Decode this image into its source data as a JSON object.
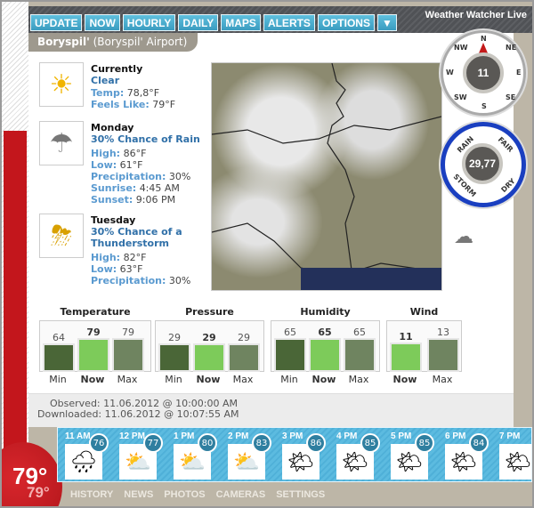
{
  "app": {
    "title": "Weather Watcher Live"
  },
  "tabs": [
    "UPDATE",
    "NOW",
    "HOURLY",
    "DAILY",
    "MAPS",
    "ALERTS",
    "OPTIONS"
  ],
  "location": {
    "name": "Boryspil'",
    "detail": "(Boryspil' Airport)"
  },
  "current": {
    "heading": "Currently",
    "condition": "Clear",
    "temp_label": "Temp:",
    "temp": "78,8°F",
    "feels_label": "Feels Like:",
    "feels": "79°F",
    "icon": "sun-icon"
  },
  "monday": {
    "heading": "Monday",
    "condition": "30% Chance of Rain",
    "high_label": "High:",
    "high": "86°F",
    "low_label": "Low:",
    "low": "61°F",
    "precip_label": "Precipitation:",
    "precip": "30%",
    "sunrise_label": "Sunrise:",
    "sunrise": "4:45 AM",
    "sunset_label": "Sunset:",
    "sunset": "9:06 PM",
    "icon": "rain-cloud-icon"
  },
  "tuesday": {
    "heading": "Tuesday",
    "condition": "30% Chance of a Thunderstorm",
    "high_label": "High:",
    "high": "82°F",
    "low_label": "Low:",
    "low": "63°F",
    "precip_label": "Precipitation:",
    "precip": "30%",
    "icon": "thunderstorm-icon"
  },
  "compass": {
    "value": "11",
    "labels": [
      "N",
      "NE",
      "E",
      "SE",
      "S",
      "SW",
      "W",
      "NW"
    ],
    "direction": "N"
  },
  "barometer": {
    "value": "29,77",
    "labels": [
      "RAIN",
      "FAIR",
      "STORM",
      "DRY"
    ]
  },
  "stats": [
    {
      "title": "Temperature",
      "bars": [
        {
          "label": "Min",
          "value": "64",
          "fraction": 0.81
        },
        {
          "label": "Now",
          "value": "79",
          "fraction": 1.0
        },
        {
          "label": "Max",
          "value": "79",
          "fraction": 1.0
        }
      ]
    },
    {
      "title": "Pressure",
      "bars": [
        {
          "label": "Min",
          "value": "29",
          "fraction": 0.82
        },
        {
          "label": "Now",
          "value": "29",
          "fraction": 0.82
        },
        {
          "label": "Max",
          "value": "29",
          "fraction": 0.82
        }
      ]
    },
    {
      "title": "Humidity",
      "bars": [
        {
          "label": "Min",
          "value": "65",
          "fraction": 1.0
        },
        {
          "label": "Now",
          "value": "65",
          "fraction": 1.0
        },
        {
          "label": "Max",
          "value": "65",
          "fraction": 1.0
        }
      ]
    },
    {
      "title": "Wind",
      "bars": [
        {
          "label": "Now",
          "value": "11",
          "fraction": 0.85
        },
        {
          "label": "Max",
          "value": "13",
          "fraction": 1.0
        }
      ]
    }
  ],
  "colors": {
    "min": "#4a6637",
    "now": "#7dcb5a",
    "max": "#6f8460",
    "accent": "#4ab0d0",
    "thermo": "#c3161c"
  },
  "footer": {
    "observed": "Observed: 11.06.2012 @ 10:00:00 AM",
    "downloaded": "Downloaded: 11.06.2012 @ 10:07:55 AM"
  },
  "thermometer": {
    "temp": "79°",
    "feels": "79°"
  },
  "hourly": [
    {
      "time": "11 AM",
      "temp": "76",
      "icon": "rain-cloud-icon"
    },
    {
      "time": "12 PM",
      "temp": "77",
      "icon": "partly-cloudy-icon"
    },
    {
      "time": "1 PM",
      "temp": "80",
      "icon": "partly-cloudy-icon"
    },
    {
      "time": "2 PM",
      "temp": "83",
      "icon": "partly-cloudy-icon"
    },
    {
      "time": "3 PM",
      "temp": "86",
      "icon": "partly-sunny-icon"
    },
    {
      "time": "4 PM",
      "temp": "85",
      "icon": "partly-sunny-icon"
    },
    {
      "time": "5 PM",
      "temp": "85",
      "icon": "partly-sunny-icon"
    },
    {
      "time": "6 PM",
      "temp": "84",
      "icon": "partly-sunny-icon"
    },
    {
      "time": "7 PM",
      "temp": "",
      "icon": "partly-sunny-icon"
    }
  ],
  "nav": [
    "HISTORY",
    "NEWS",
    "PHOTOS",
    "CAMERAS",
    "SETTINGS"
  ]
}
